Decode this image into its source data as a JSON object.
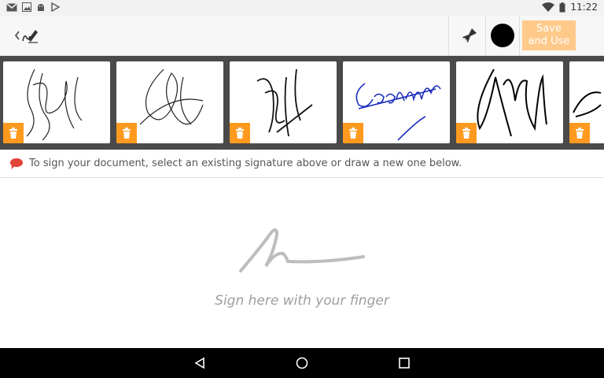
{
  "status_bar": {
    "time": "11:22",
    "icons_left": [
      "gmail-icon",
      "image-icon",
      "android-icon",
      "play-store-icon"
    ],
    "icons_right": [
      "wifi-icon",
      "battery-icon"
    ]
  },
  "toolbar": {
    "back_icon": "back-arrow-icon",
    "app_icon": "signature-pen-icon",
    "clear_icon": "brush-icon",
    "pen_color": "#000000",
    "save_label_line1": "Save",
    "save_label_line2": "and Use"
  },
  "signatures": [
    {
      "ink": "#222222",
      "delete_icon": "trash-icon"
    },
    {
      "ink": "#222222",
      "delete_icon": "trash-icon"
    },
    {
      "ink": "#111111",
      "delete_icon": "trash-icon"
    },
    {
      "ink": "#1a2dbf",
      "delete_icon": "trash-icon"
    },
    {
      "ink": "#000000",
      "delete_icon": "trash-icon"
    },
    {
      "ink": "#000000",
      "delete_icon": "trash-icon"
    }
  ],
  "hint": {
    "icon": "speech-bubble-icon",
    "text": "To sign your document, select an existing signature above or draw a new one below."
  },
  "draw_area": {
    "prompt": "Sign here with your finger"
  },
  "nav_bar": {
    "back": "nav-back-icon",
    "home": "nav-home-icon",
    "recents": "nav-recents-icon"
  },
  "colors": {
    "accent": "#ff9a1f",
    "save_bg": "#ffc98a",
    "strip_bg": "#4a4a4a"
  }
}
